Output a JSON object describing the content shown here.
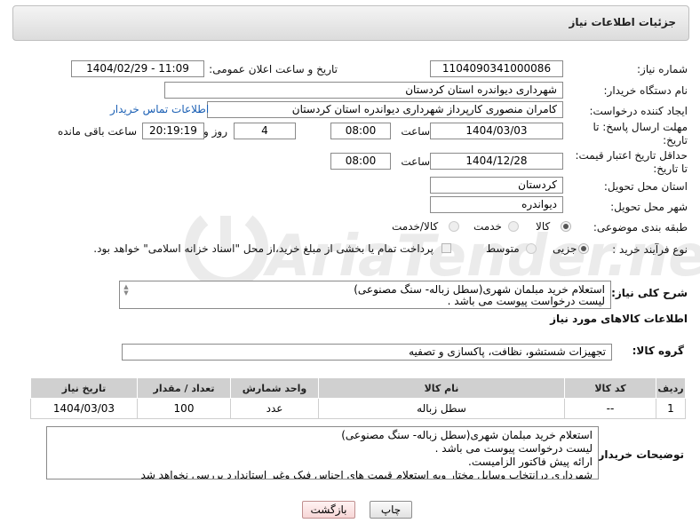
{
  "header": {
    "title": "جزئیات اطلاعات نیاز"
  },
  "fields": {
    "need_number_label": "شماره نیاز:",
    "need_number": "1104090341000086",
    "announce_label": "تاریخ و ساعت اعلان عمومی:",
    "announce_value": "1404/02/29 - 11:09",
    "buyer_org_label": "نام دستگاه خریدار:",
    "buyer_org": "شهرداری دیواندره استان کردستان",
    "creator_label": "ایجاد کننده درخواست:",
    "creator": "کامران منصوری کارپرداز شهرداری دیواندره استان کردستان",
    "contact_link": "اطلاعات تماس خریدار",
    "deadline_label_1": "مهلت ارسال پاسخ: تا",
    "deadline_label_2": "تاریخ:",
    "deadline_date": "1404/03/03",
    "time_label": "ساعت",
    "deadline_time": "08:00",
    "days_value": "4",
    "days_label": "روز و",
    "remaining_time": "20:19:19",
    "remaining_label": "ساعت باقی مانده",
    "validity_label_1": "حداقل تاریخ اعتبار قیمت:",
    "validity_label_2": "تا تاریخ:",
    "validity_date": "1404/12/28",
    "validity_time": "08:00",
    "province_label": "استان محل تحویل:",
    "province": "کردستان",
    "city_label": "شهر محل تحویل:",
    "city": "دیواندره",
    "category_label": "طبقه بندی موضوعی:",
    "category_options": [
      "کالا",
      "خدمت",
      "کالا/خدمت"
    ],
    "process_label": "نوع فرآیند خرید :",
    "process_options": [
      "جزیی",
      "متوسط"
    ],
    "payment_note": "پرداخت تمام یا بخشی از مبلغ خرید،از محل \"اسناد خزانه اسلامی\" خواهد بود.",
    "general_desc_label": "شرح کلی نیاز:",
    "general_desc_lines": [
      "استعلام خرید مبلمان شهری(سطل زباله- سنگ مصنوعی)",
      "لیست درخواست پیوست می باشد ."
    ],
    "goods_info_title": "اطلاعات کالاهای مورد نیاز",
    "goods_group_label": "گروه کالا:",
    "goods_group": "تجهیزات شستشو، نظافت، پاکسازی و تصفیه"
  },
  "table": {
    "headers": [
      "ردیف",
      "کد کالا",
      "نام کالا",
      "واحد شمارش",
      "تعداد / مقدار",
      "تاریخ نیاز"
    ],
    "rows": [
      [
        "1",
        "--",
        "سطل زباله",
        "عدد",
        "100",
        "1404/03/03"
      ]
    ]
  },
  "buyer_notes": {
    "label": "توضیحات خریدار:",
    "lines": [
      "استعلام خرید مبلمان شهری(سطل زباله- سنگ مصنوعی)",
      "لیست درخواست پیوست می باشد .",
      "ارائه پیش فاکتور الزامیست.",
      "شهرداری درانتخاب وسایل مختار وبه استعلام قیمت های اجناس فیک وغیر استاندارد بررسی نخواهد شد"
    ]
  },
  "buttons": {
    "print": "چاپ",
    "back": "بازگشت"
  },
  "watermark": {
    "text": "AriaTender.neT"
  },
  "colors": {
    "link": "#1a5fb4",
    "header_bg": "#e6e6e6",
    "table_header": "#d0d0d0",
    "back_button": "#f7d6d6"
  }
}
